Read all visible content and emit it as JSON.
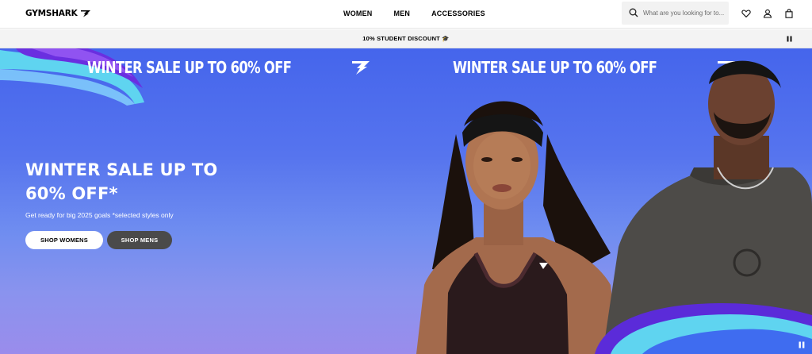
{
  "header": {
    "logo_text": "GYMSHARK",
    "nav": [
      "WOMEN",
      "MEN",
      "ACCESSORIES"
    ],
    "search_placeholder": "What are you looking for to..."
  },
  "promo": {
    "text": "10% STUDENT DISCOUNT 🎓"
  },
  "hero": {
    "marquee": [
      "WINTER SALE UP TO 60% OFF",
      "WINTER SALE UP TO 60% OFF"
    ],
    "title_line1": "WINTER SALE UP TO",
    "title_line2": "60% OFF*",
    "subtitle": "Get ready for big 2025 goals *selected styles only",
    "button_women": "SHOP WOMENS",
    "button_men": "SHOP MENS"
  },
  "colors": {
    "hero_top": "#4565ec",
    "hero_bottom": "#9a8cec",
    "swirl_purple": "#5b2bd9",
    "swirl_cyan": "#5fd4f0"
  }
}
